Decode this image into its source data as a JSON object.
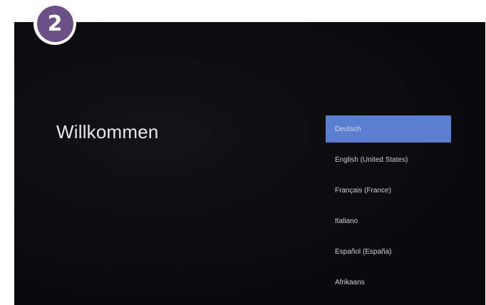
{
  "step_badge": {
    "number": "2",
    "color": "#6b4f87"
  },
  "screen": {
    "title": "Willkommen",
    "languages": [
      {
        "label": "Deutsch",
        "selected": true
      },
      {
        "label": "English (United States)",
        "selected": false
      },
      {
        "label": "Français (France)",
        "selected": false
      },
      {
        "label": "Italiano",
        "selected": false
      },
      {
        "label": "Español (España)",
        "selected": false
      },
      {
        "label": "Afrikaans",
        "selected": false
      }
    ],
    "accent_color": "#5b7fd0"
  }
}
